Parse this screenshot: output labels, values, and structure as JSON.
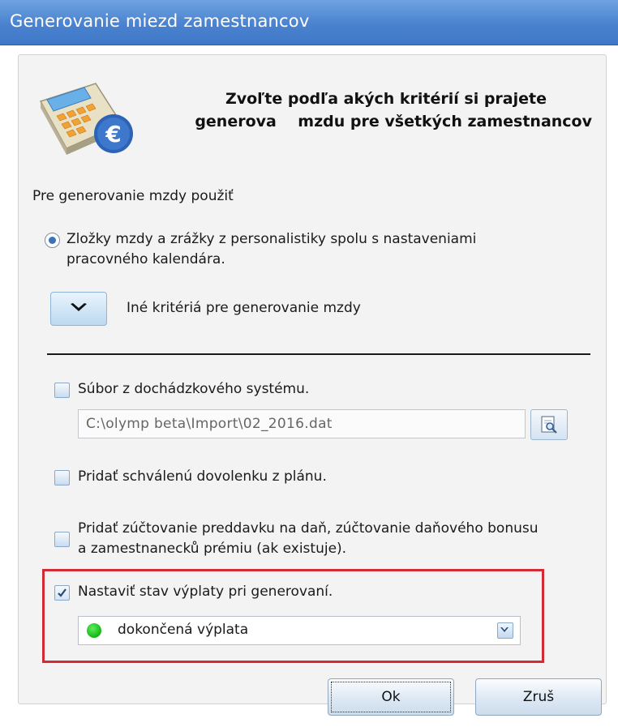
{
  "window": {
    "title": "Generovanie miezd zamestnancov"
  },
  "header": {
    "line1": "Zvoľte podľa akých kritérií si prajete",
    "line2": "generova    mzdu pre všetkých zamestnancov",
    "icon": "calculator-euro-icon"
  },
  "section_label": "Pre generovanie mzdy použiť",
  "radio_option": {
    "label": "Zložky mzdy a zrážky z personalistiky spolu s nastaveniami pracovného kalendára.",
    "selected": true
  },
  "expander": {
    "label": "Iné kritériá pre generovanie mzdy",
    "icon": "chevron-down-icon"
  },
  "attendance_file": {
    "label": "Súbor z dochádzkového systému.",
    "checked": false,
    "path": "C:\\olymp beta\\Import\\02_2016.dat",
    "browse_icon": "browse-file-icon"
  },
  "vacation": {
    "label": "Pridať schválenú dovolenku z plánu.",
    "checked": false
  },
  "tax_settlement": {
    "label": "Pridať zúčtovanie preddavku na daň, zúčtovanie daňového bonusu a zamestnanecků prémiu (ak existuje).",
    "checked": false
  },
  "payout_state": {
    "label": "Nastaviť stav výplaty pri generovaní.",
    "checked": true,
    "selected_value": "dokončená výplata",
    "status_color": "#15b515"
  },
  "buttons": {
    "ok": "Ok",
    "cancel": "Zruš"
  },
  "colors": {
    "title_bar": "#4a82cf",
    "highlight_border": "#d32a34"
  }
}
